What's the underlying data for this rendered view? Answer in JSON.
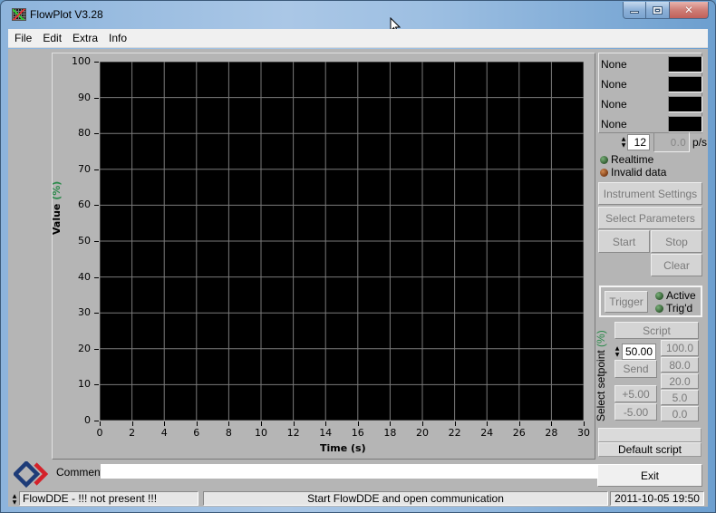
{
  "window": {
    "title": "FlowPlot V3.28",
    "controls": {
      "minimize": "minimize",
      "maximize": "maximize",
      "close": "✕"
    }
  },
  "menu": {
    "items": [
      "File",
      "Edit",
      "Extra",
      "Info"
    ]
  },
  "graph": {
    "y_label": "Value ",
    "y_label_unit": "(%)",
    "x_label": "Time (s)"
  },
  "chart_data": {
    "type": "line",
    "title": "",
    "xlabel": "Time (s)",
    "ylabel": "Value (%)",
    "xlim": [
      0,
      30
    ],
    "ylim": [
      0,
      100
    ],
    "x_ticks": [
      0,
      2,
      4,
      6,
      8,
      10,
      12,
      14,
      16,
      18,
      20,
      22,
      24,
      26,
      28,
      30
    ],
    "y_ticks": [
      0,
      10,
      20,
      30,
      40,
      50,
      60,
      70,
      80,
      90,
      100
    ],
    "grid": true,
    "background": "#000000",
    "grid_color": "#7a7a7a",
    "series": []
  },
  "channels": [
    {
      "label": "None",
      "color": "#000000"
    },
    {
      "label": "None",
      "color": "#000000"
    },
    {
      "label": "None",
      "color": "#000000"
    },
    {
      "label": "None",
      "color": "#000000"
    }
  ],
  "rate": {
    "points": "12",
    "value": "0.0",
    "unit": "p/s"
  },
  "indicators": {
    "realtime": "Realtime",
    "invalid": "Invalid data",
    "active": "Active",
    "trigd": "Trig'd"
  },
  "buttons": {
    "instrument_settings": "Instrument Settings",
    "select_parameters": "Select Parameters",
    "start": "Start",
    "stop": "Stop",
    "clear": "Clear",
    "trigger": "Trigger",
    "script": "Script",
    "send": "Send",
    "plus": "+5.00",
    "minus": "-5.00",
    "exit": "Exit"
  },
  "setpoint": {
    "title": "Select setpoint ",
    "title_unit": "(%)",
    "value": "50.00",
    "presets": [
      "100.0",
      "80.0",
      "20.0",
      "5.0",
      "0.0"
    ]
  },
  "script": {
    "name_blank": "",
    "default": "Default script"
  },
  "comment": {
    "label": "Comment",
    "value": ""
  },
  "status": {
    "left": "FlowDDE - !!! not present !!!",
    "center": "Start FlowDDE and open communication",
    "datetime": "2011-10-05  19:50"
  }
}
